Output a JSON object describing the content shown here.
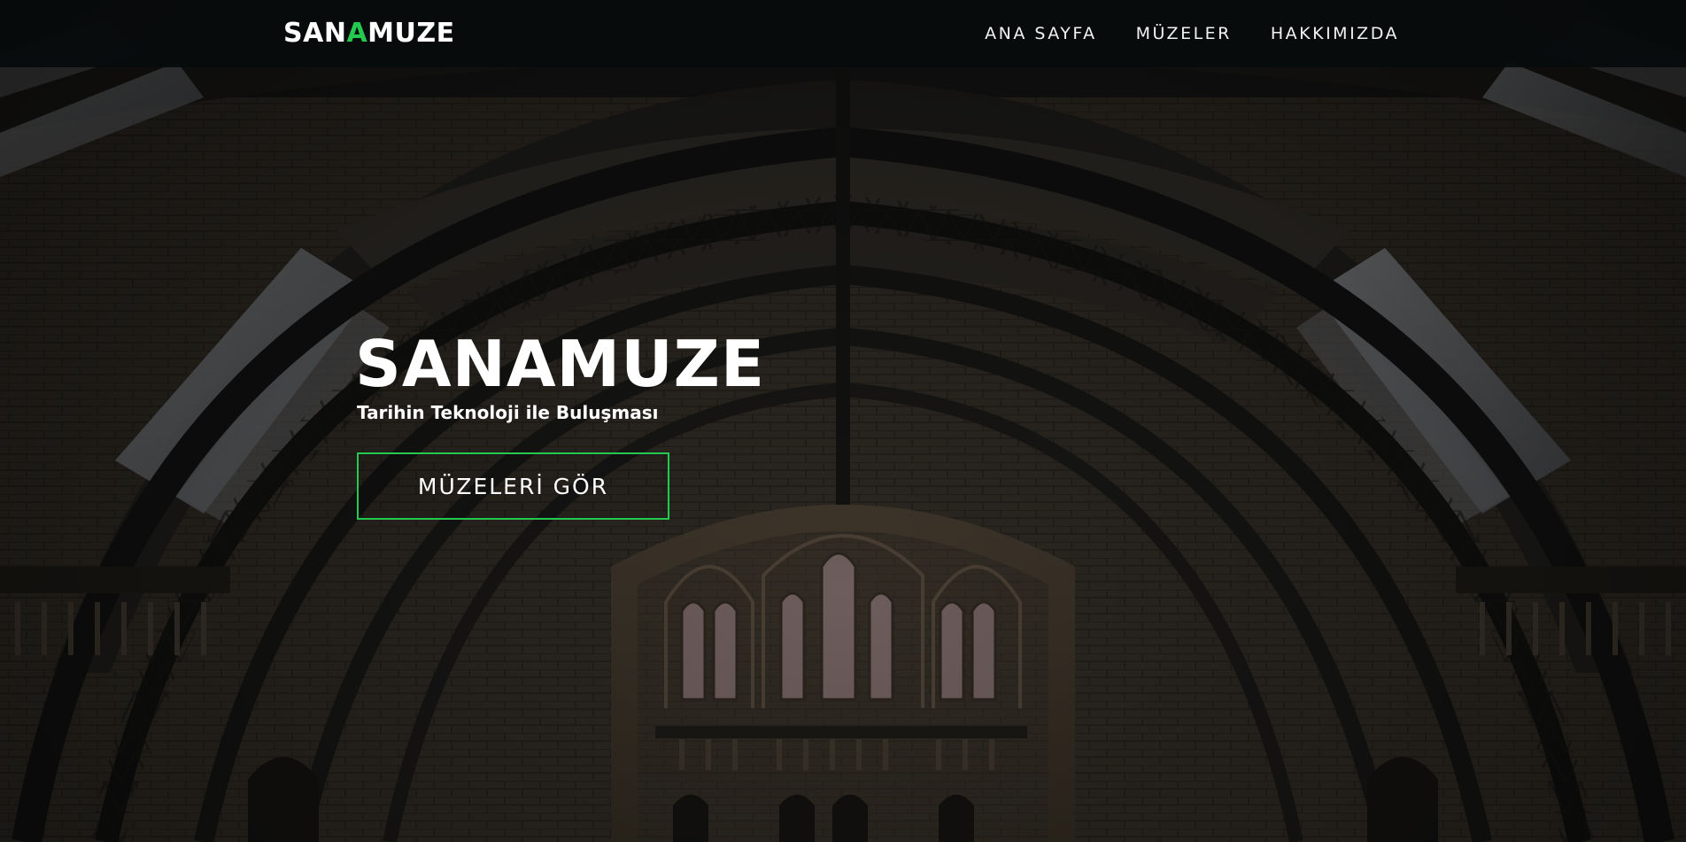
{
  "brand": {
    "logo_part1": "SAN",
    "logo_accent": "A",
    "logo_part2": "MUZE",
    "accent_color": "#26c94f"
  },
  "nav": {
    "items": [
      {
        "label": "ANA SAYFA"
      },
      {
        "label": "MÜZELER"
      },
      {
        "label": "HAKKIMIZDA"
      }
    ]
  },
  "hero": {
    "title": "SANAMUZE",
    "subtitle": "Tarihin Teknoloji ile Buluşması",
    "cta_label": "MÜZELERİ GÖR",
    "background": "museum-hall-photo"
  }
}
